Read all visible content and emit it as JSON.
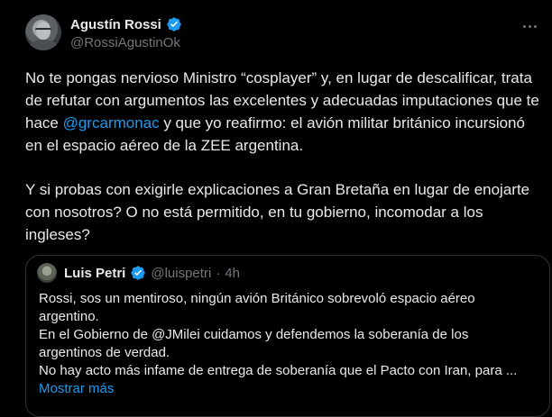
{
  "tweet": {
    "author_name": "Agustín Rossi",
    "author_handle": "@RossiAgustinOk",
    "paragraph1_part1": "No te pongas nervioso Ministro “cosplayer” y, en lugar de descalificar, trata de refutar con argumentos las excelentes y adecuadas imputaciones que te hace ",
    "paragraph1_mention": "@grcarmonac",
    "paragraph1_part2": " y que yo reafirmo: el avión militar británico incursionó en el espacio aéreo de la ZEE argentina.",
    "paragraph2": "Y si probas con exigirle explicaciones a Gran Bretaña en lugar de enojarte con nosotros? O no está permitido, en tu gobierno, incomodar a los ingleses?"
  },
  "quote": {
    "author_name": "Luis Petri",
    "author_handle": "@luispetri",
    "separator": "·",
    "time": "4h",
    "line1": "Rossi, sos un mentiroso, ningún avión Británico sobrevoló espacio aéreo argentino.",
    "line2": "En el Gobierno de @JMilei cuidamos y defendemos la soberanía de los argentinos de verdad.",
    "line3": "No hay acto más infame de entrega de soberanía que el Pacto con Iran, para ...",
    "show_more": "Mostrar más"
  },
  "icons": {
    "verified": "verified-badge-icon",
    "more": "more-options-icon"
  },
  "colors": {
    "background": "#000000",
    "text": "#e7e9ea",
    "secondary": "#71767b",
    "accent": "#1d9bf0",
    "border": "#2f3336"
  }
}
